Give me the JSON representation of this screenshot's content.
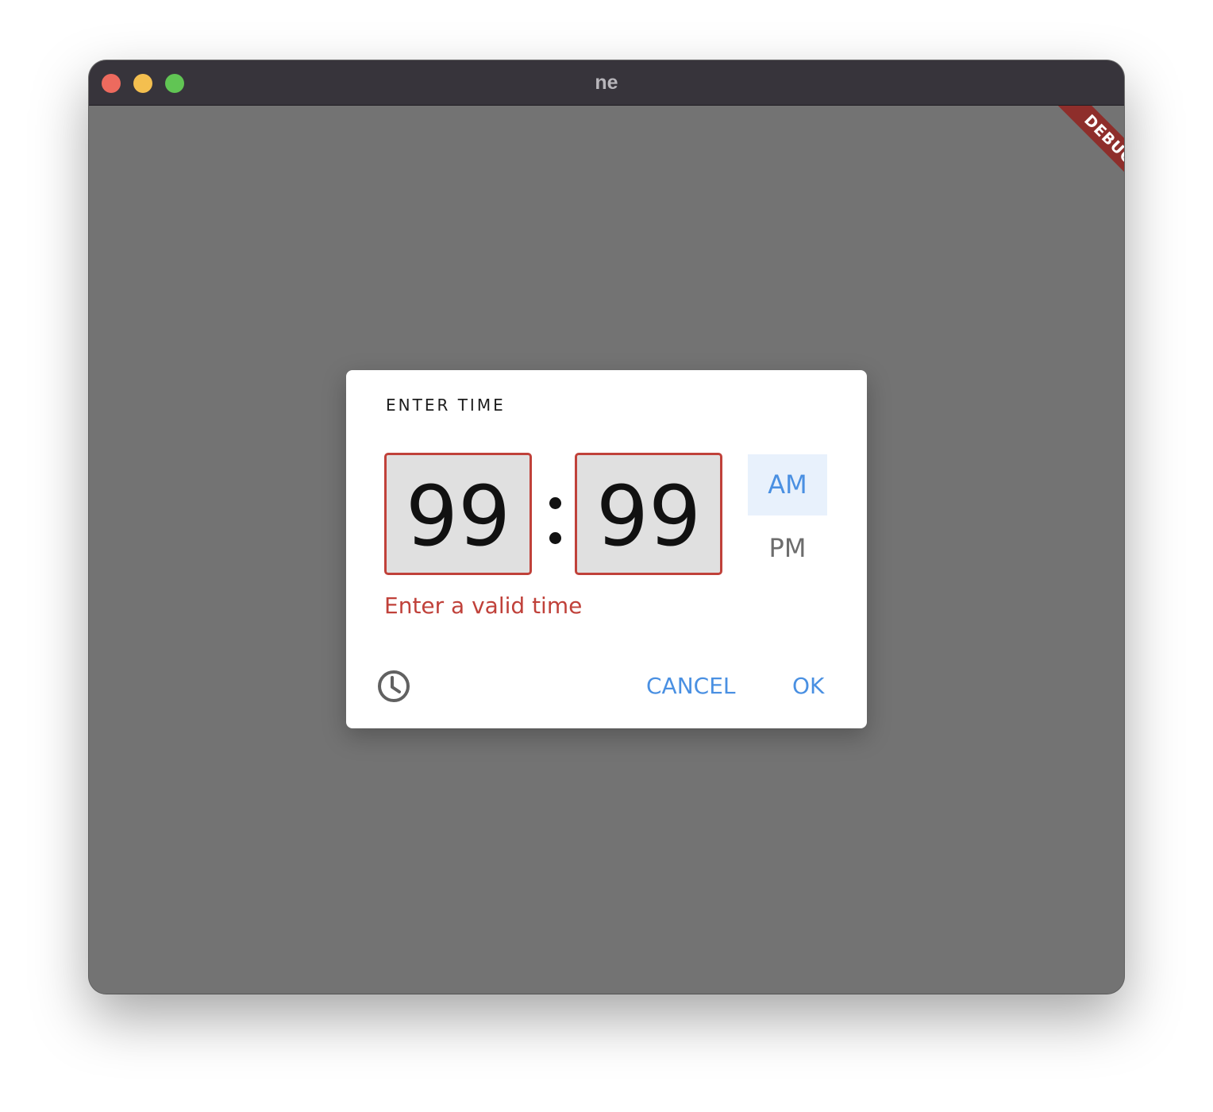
{
  "window": {
    "title": "ne",
    "debug_banner": "DEBUG"
  },
  "dialog": {
    "title": "ENTER TIME",
    "hours": "99",
    "minutes": "99",
    "period_am": "AM",
    "period_pm": "PM",
    "selected_period": "AM",
    "error": "Enter a valid time",
    "cancel_label": "CANCEL",
    "ok_label": "OK",
    "mode_icon": "clock-icon"
  },
  "colors": {
    "accent": "#4a90e2",
    "error": "#c0413a",
    "titlebar": "#37343b",
    "scrim": "#737373"
  }
}
